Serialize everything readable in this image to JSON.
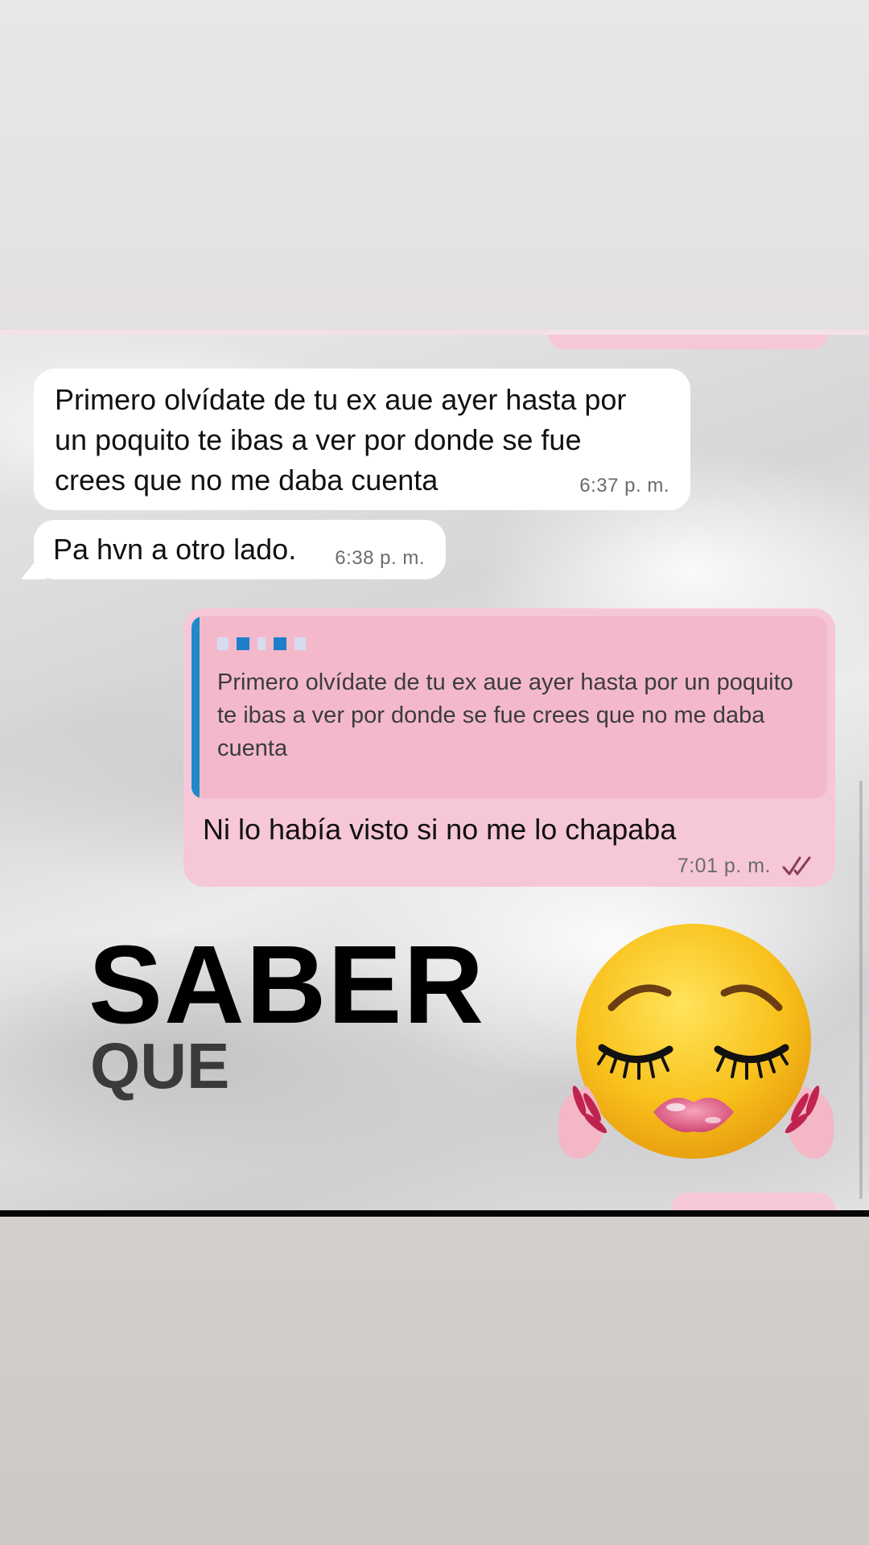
{
  "chat": {
    "messages": [
      {
        "direction": "incoming",
        "text": "Primero olvídate de tu ex aue ayer hasta por un poquito te ibas a ver por donde se fue crees que no me daba cuenta",
        "time": "6:37 p. m."
      },
      {
        "direction": "incoming",
        "text": "Pa hvn a otro lado.",
        "time": "6:38 p. m."
      },
      {
        "direction": "outgoing",
        "quoted_text": "Primero olvídate de tu ex aue ayer hasta por un poquito te ibas a ver por donde se fue crees que no me daba cuenta",
        "text": "Ni lo había visto si no me lo chapaba",
        "time": "7:01 p. m.",
        "status_icon": "double-check-icon"
      }
    ]
  },
  "overlay": {
    "title": "SABER",
    "subtitle": "QUE",
    "sticker_icon": "pleading-face-lashes-lips-emoji"
  },
  "colors": {
    "incoming_bubble": "#ffffff",
    "outgoing_bubble": "#f6c7d7",
    "quote_background": "#f3b9cb",
    "quote_bar": "#1f8acb",
    "ticks": "#8a3a5a"
  }
}
